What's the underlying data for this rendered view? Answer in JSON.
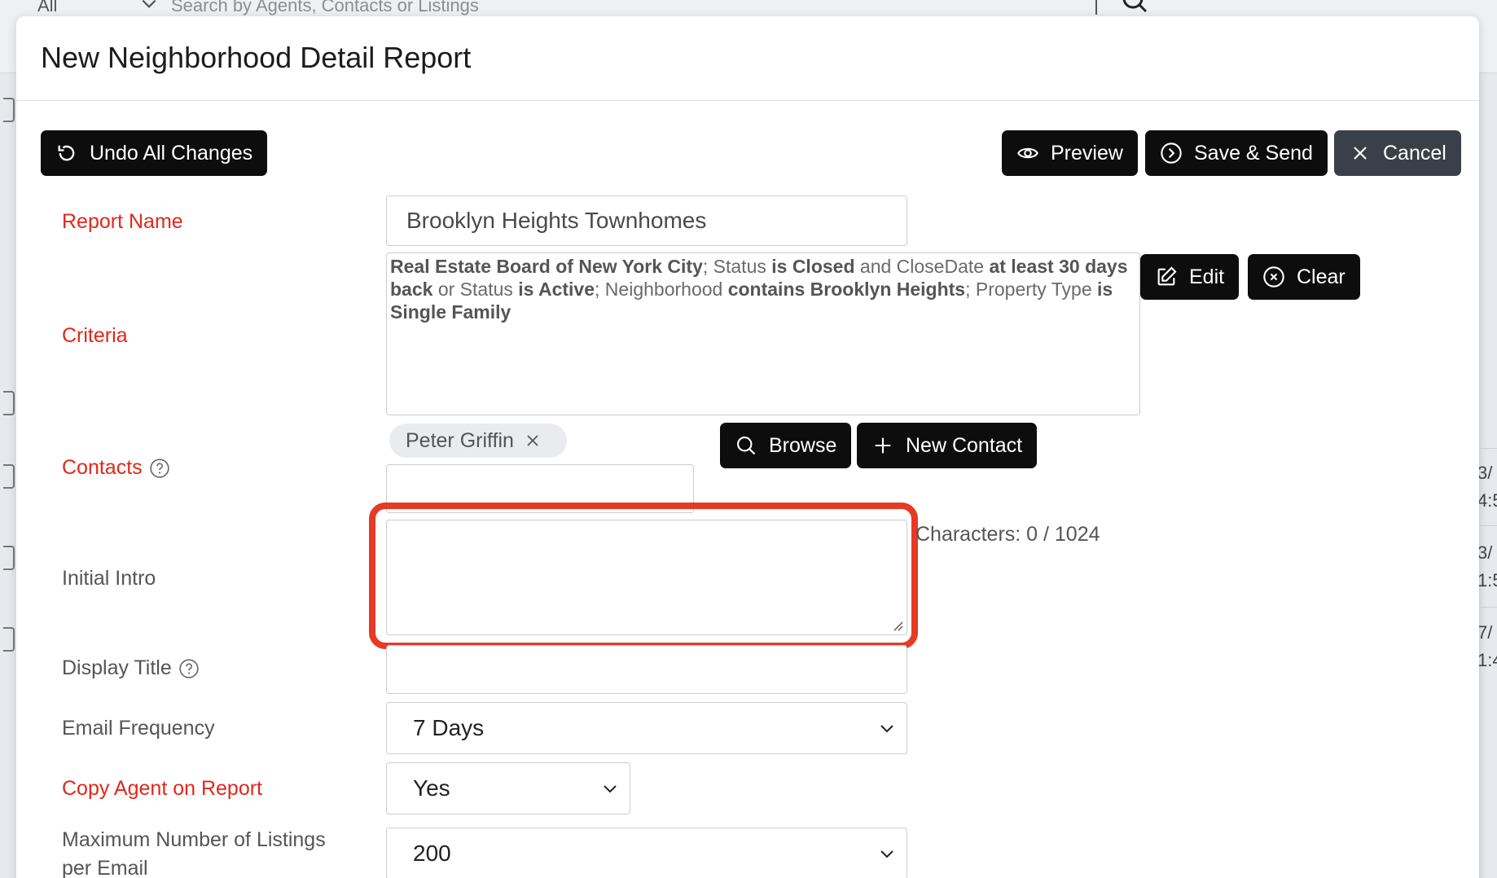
{
  "background": {
    "scope_value": "All",
    "search_placeholder": "Search by Agents, Contacts or Listings",
    "right_fragments": [
      "3/",
      "4:5",
      "3/",
      "1:5",
      "7/",
      "1:4"
    ]
  },
  "modal": {
    "title": "New Neighborhood Detail Report",
    "toolbar": {
      "undo_label": "Undo All Changes",
      "preview_label": "Preview",
      "save_send_label": "Save & Send",
      "cancel_label": "Cancel"
    },
    "report_name": {
      "label": "Report Name",
      "value": "Brooklyn Heights Townhomes"
    },
    "criteria": {
      "label": "Criteria",
      "segments": [
        {
          "text": "Real Estate Board of New York City",
          "bold": true
        },
        {
          "text": "; Status ",
          "bold": false
        },
        {
          "text": "is Closed",
          "bold": true
        },
        {
          "text": " and CloseDate ",
          "bold": false
        },
        {
          "text": "at least 30 days back",
          "bold": true
        },
        {
          "text": " or Status ",
          "bold": false
        },
        {
          "text": "is Active",
          "bold": true
        },
        {
          "text": "; Neighborhood ",
          "bold": false
        },
        {
          "text": "contains Brooklyn Heights",
          "bold": true
        },
        {
          "text": "; Property Type ",
          "bold": false
        },
        {
          "text": "is Single Family",
          "bold": true
        }
      ],
      "edit_label": "Edit",
      "clear_label": "Clear"
    },
    "contacts": {
      "label": "Contacts",
      "chips": [
        "Peter Griffin"
      ],
      "input_value": "",
      "browse_label": "Browse",
      "new_contact_label": "New Contact"
    },
    "initial_intro": {
      "label": "Initial Intro",
      "value": "",
      "char_count": "Characters: 0 / 1024"
    },
    "display_title": {
      "label": "Display Title",
      "value": ""
    },
    "email_frequency": {
      "label": "Email Frequency",
      "selected": "7 Days"
    },
    "copy_agent": {
      "label": "Copy Agent on Report",
      "selected": "Yes"
    },
    "max_listings": {
      "label_line1": "Maximum Number of Listings",
      "label_line2": "per Email",
      "selected": "200"
    }
  },
  "colors": {
    "required_label": "#e0281b",
    "button_bg": "#0d0d0d",
    "cancel_bg": "#3a4049",
    "highlight": "#e53a26"
  }
}
